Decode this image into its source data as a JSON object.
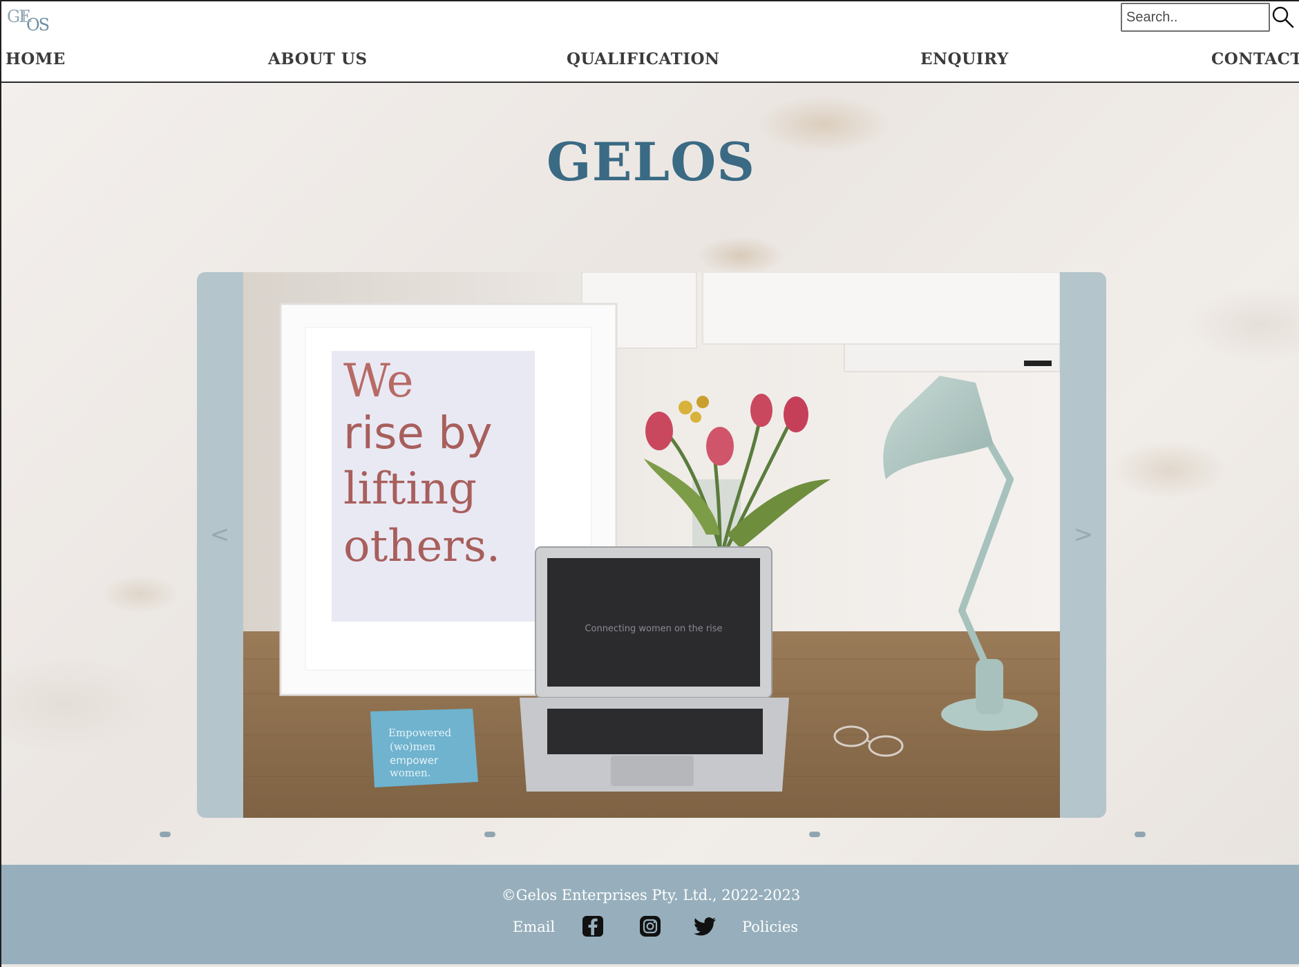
{
  "header": {
    "logo_text": "GELOS",
    "search": {
      "placeholder": "Search..",
      "value": ""
    },
    "nav": [
      {
        "label": "HOME"
      },
      {
        "label": "ABOUT US"
      },
      {
        "label": "QUALIFICATION"
      },
      {
        "label": "ENQUIRY"
      },
      {
        "label": "CONTACT"
      }
    ]
  },
  "main": {
    "title": "GELOS",
    "slider": {
      "prev_label": "<",
      "next_label": ">",
      "slide": {
        "poster_text": "We rise by lifting others.",
        "book_text": "Empowered (wo)men empower women.",
        "screen_text": "Connecting women on the rise"
      },
      "dot_count": 4,
      "active_index": 0
    }
  },
  "footer": {
    "copyright": "©Gelos Enterprises Pty. Ltd., 2022-2023",
    "email_label": "Email",
    "policies_label": "Policies",
    "social_icons": [
      "facebook-icon",
      "instagram-icon",
      "twitter-icon"
    ]
  },
  "colors": {
    "title": "#3a6a84",
    "slider_bg": "#b4c5cb",
    "footer_bg": "#97afbc",
    "nav_text": "#3b3b3b"
  }
}
